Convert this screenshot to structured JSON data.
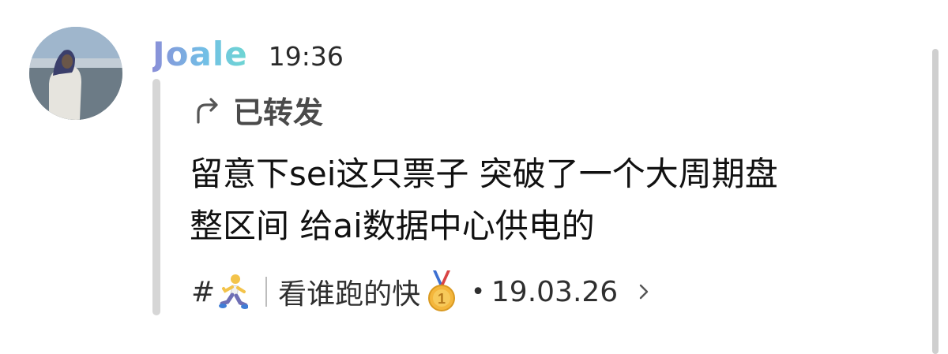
{
  "message": {
    "author": "Joale",
    "time": "19:36",
    "forward_label": "已转发",
    "text_lines": [
      "留意下sei这只票子 突破了一个大周期盘",
      "整区间 给ai数据中心供电的"
    ]
  },
  "source": {
    "hash": "#",
    "channel_name": "看谁跑的快",
    "dot": "•",
    "date": "19.03.26"
  },
  "icons": {
    "avatar": "avatar-photo",
    "forward": "forward-arrow-icon",
    "runner": "person-running-emoji",
    "medal": "first-place-medal-emoji",
    "chevron": "chevron-right-icon"
  },
  "colors": {
    "username_gradient_start": "#8a8fd8",
    "username_gradient_end": "#6ed6d2",
    "quote_bar": "#d6d6d6",
    "text": "#111111"
  }
}
